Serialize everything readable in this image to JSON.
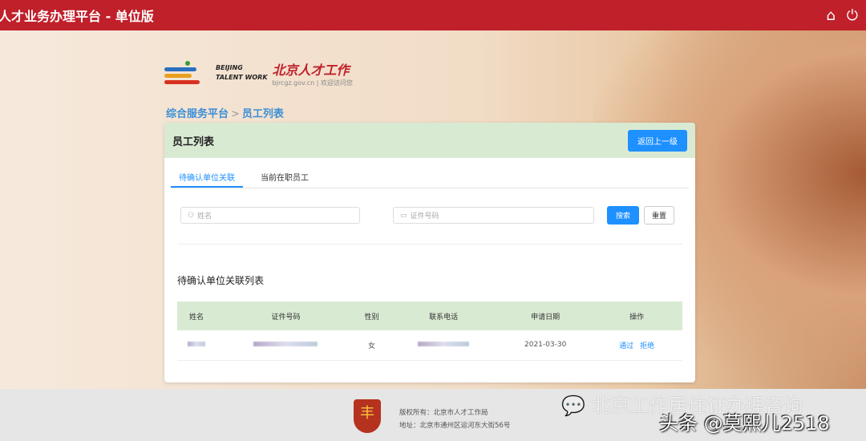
{
  "header": {
    "title": "人才业务办理平台 - 单位版",
    "icons": [
      "home-icon",
      "power-icon"
    ]
  },
  "logo": {
    "en_line1": "BEIJING",
    "en_line2": "TALENT WORK",
    "cn": "北京人才工作",
    "url": "bjrcgz.gov.cn | 欢迎访问您"
  },
  "breadcrumb": {
    "root": "综合服务平台",
    "separator": ">",
    "current": "员工列表"
  },
  "panel": {
    "title": "员工列表",
    "back_label": "返回上一级"
  },
  "tabs": [
    {
      "label": "待确认单位关联",
      "active": true
    },
    {
      "label": "当前在职员工",
      "active": false
    }
  ],
  "search": {
    "name_placeholder": "姓名",
    "id_placeholder": "证件号码",
    "search_label": "搜索",
    "reset_label": "重置"
  },
  "list": {
    "title": "待确认单位关联列表",
    "columns": [
      "姓名",
      "证件号码",
      "性别",
      "联系电话",
      "申请日期",
      "操作"
    ],
    "rows": [
      {
        "gender": "女",
        "date": "2021-03-30",
        "actions": [
          "通过",
          "拒绝"
        ]
      }
    ]
  },
  "footer": {
    "copyright": "版权所有：北京市人才工作局",
    "address": "地址：北京市通州区运河东大街56号"
  },
  "watermark": {
    "line1": "北京工作居住证办理咨询",
    "line2": "头条 @莫熙儿2518"
  }
}
